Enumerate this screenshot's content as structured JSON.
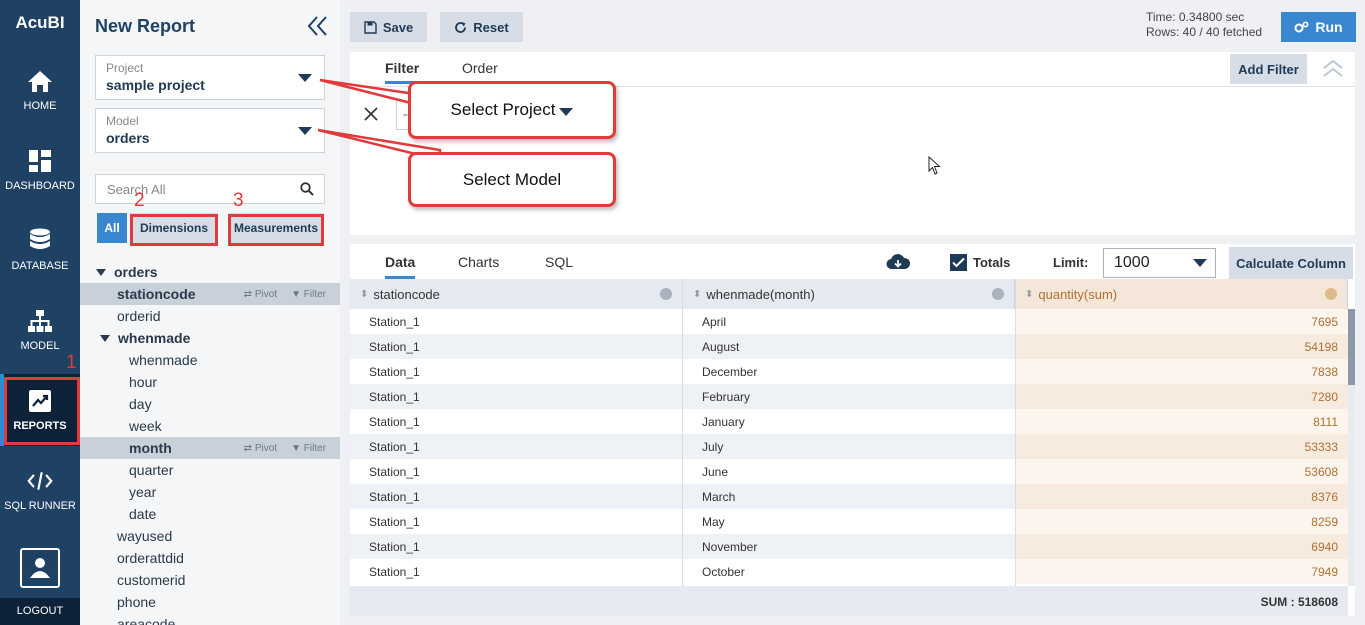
{
  "app": {
    "name": "AcuBI"
  },
  "nav": {
    "items": [
      {
        "label": "HOME",
        "icon": "home-icon"
      },
      {
        "label": "DASHBOARD",
        "icon": "dashboard-icon"
      },
      {
        "label": "DATABASE",
        "icon": "database-icon"
      },
      {
        "label": "MODEL",
        "icon": "model-icon"
      },
      {
        "label": "REPORTS",
        "icon": "reports-icon",
        "active": true
      },
      {
        "label": "SQL RUNNER",
        "icon": "code-icon"
      }
    ],
    "logout": "LOGOUT"
  },
  "side": {
    "title": "New Report",
    "project": {
      "label": "Project",
      "value": "sample project"
    },
    "model": {
      "label": "Model",
      "value": "orders"
    },
    "search_placeholder": "Search All",
    "filter_tabs": {
      "all": "All",
      "dimensions": "Dimensions",
      "measurements": "Measurements"
    },
    "tree": [
      {
        "label": "orders",
        "kind": "group",
        "indent": 0
      },
      {
        "label": "stationcode",
        "kind": "field",
        "indent": 1,
        "selected": true
      },
      {
        "label": "orderid",
        "kind": "field",
        "indent": 1
      },
      {
        "label": "whenmade",
        "kind": "group",
        "indent": 1
      },
      {
        "label": "whenmade",
        "kind": "field",
        "indent": 2
      },
      {
        "label": "hour",
        "kind": "field",
        "indent": 2
      },
      {
        "label": "day",
        "kind": "field",
        "indent": 2
      },
      {
        "label": "week",
        "kind": "field",
        "indent": 2
      },
      {
        "label": "month",
        "kind": "field",
        "indent": 2,
        "selected": true
      },
      {
        "label": "quarter",
        "kind": "field",
        "indent": 2
      },
      {
        "label": "year",
        "kind": "field",
        "indent": 2
      },
      {
        "label": "date",
        "kind": "field",
        "indent": 2
      },
      {
        "label": "wayused",
        "kind": "field",
        "indent": 1
      },
      {
        "label": "orderattdid",
        "kind": "field",
        "indent": 1
      },
      {
        "label": "customerid",
        "kind": "field",
        "indent": 1
      },
      {
        "label": "phone",
        "kind": "field",
        "indent": 1
      },
      {
        "label": "areacode",
        "kind": "field",
        "indent": 1
      }
    ],
    "row_actions": {
      "pivot": "Pivot",
      "filter": "Filter"
    }
  },
  "toolbar": {
    "save": "Save",
    "reset": "Reset",
    "time": "Time: 0.34800 sec",
    "rows": "Rows: 40 / 40 fetched",
    "run": "Run"
  },
  "filter_panel": {
    "tabs": {
      "filter": "Filter",
      "order": "Order"
    },
    "add_filter": "Add Filter",
    "select_value": "------"
  },
  "annotations": {
    "select_project": "Select Project",
    "select_model": "Select Model",
    "num1": "1",
    "num2": "2",
    "num3": "3"
  },
  "data_panel": {
    "tabs": {
      "data": "Data",
      "charts": "Charts",
      "sql": "SQL"
    },
    "totals_label": "Totals",
    "totals_checked": true,
    "limit_label": "Limit:",
    "limit_value": "1000",
    "calc_column": "Calculate Column"
  },
  "grid": {
    "columns": [
      "stationcode",
      "whenmade(month)",
      "quantity(sum)"
    ],
    "rows": [
      [
        "Station_1",
        "April",
        "7695"
      ],
      [
        "Station_1",
        "August",
        "54198"
      ],
      [
        "Station_1",
        "December",
        "7838"
      ],
      [
        "Station_1",
        "February",
        "7280"
      ],
      [
        "Station_1",
        "January",
        "8111"
      ],
      [
        "Station_1",
        "July",
        "53333"
      ],
      [
        "Station_1",
        "June",
        "53608"
      ],
      [
        "Station_1",
        "March",
        "8376"
      ],
      [
        "Station_1",
        "May",
        "8259"
      ],
      [
        "Station_1",
        "November",
        "6940"
      ],
      [
        "Station_1",
        "October",
        "7949"
      ]
    ],
    "sum_label": "SUM : 518608"
  },
  "colors": {
    "nav_bg": "#1f4163",
    "accent": "#3a87d0",
    "annotation_red": "#e03a3a",
    "measure_text": "#b07030"
  }
}
